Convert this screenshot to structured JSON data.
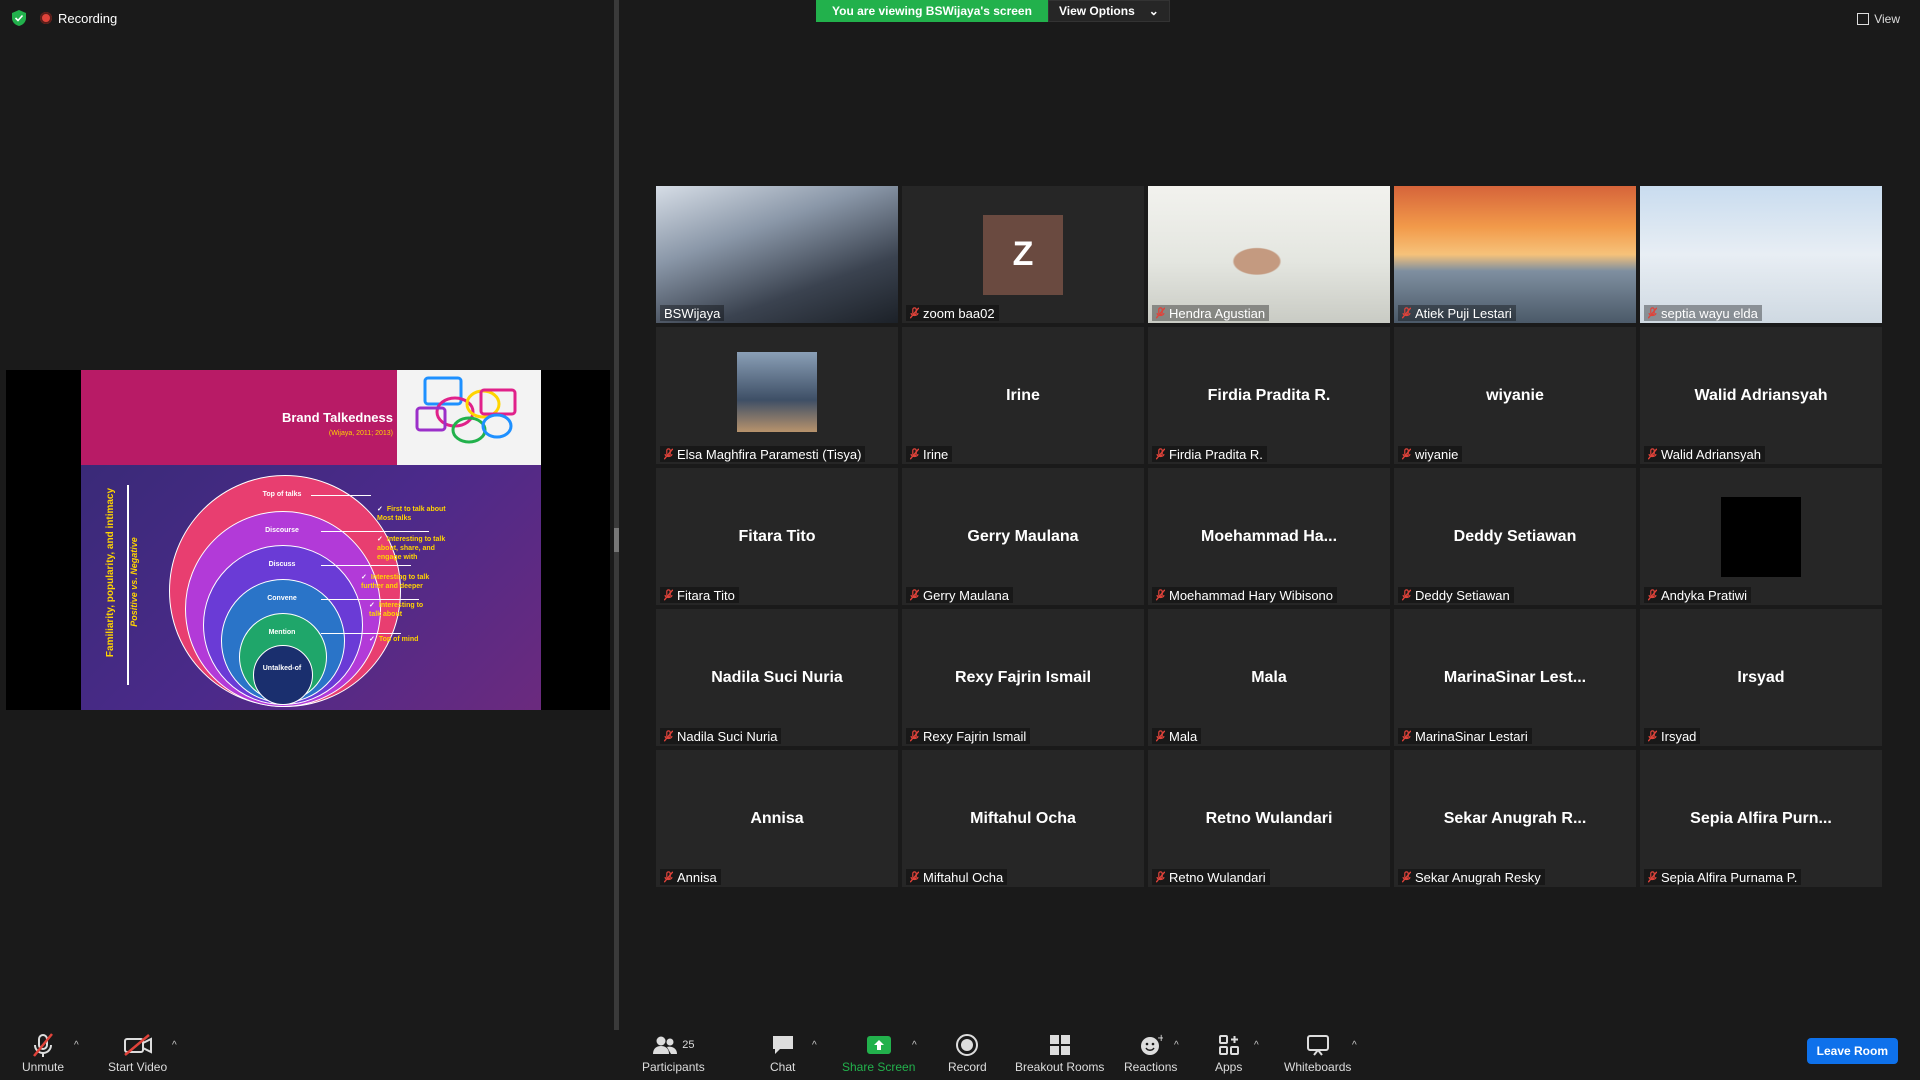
{
  "status": {
    "recording_label": "Recording"
  },
  "banner": {
    "viewing_text": "You are viewing BSWijaya's screen",
    "view_options_label": "View Options"
  },
  "view_button": {
    "label": "View"
  },
  "slide": {
    "title": "Brand Talkedness",
    "citation": "(Wijaya, 2011; 2013)",
    "vertical_axis": "Familiarity, popularity, and intimacy",
    "vertical_axis2": "Positive vs. Negative",
    "levels": [
      "Top of talks",
      "Discourse",
      "Discuss",
      "Convene",
      "Mention",
      "Untalked-of"
    ],
    "notes": [
      "First to talk about\nMost talks",
      "Interesting to talk\nabout, share, and\nengage with",
      "Interesting to talk\nfurther and deeper",
      "Interesting to\ntalk about",
      "Top of mind"
    ]
  },
  "tiles": [
    {
      "name": "BSWijaya",
      "center": "",
      "kind": "video-city",
      "active": true,
      "muted": false
    },
    {
      "name": "zoom baa02",
      "center": "",
      "kind": "avatar-z",
      "active": false,
      "muted": true
    },
    {
      "name": "Hendra Agustian",
      "center": "",
      "kind": "video-office",
      "active": false,
      "muted": true
    },
    {
      "name": "Atiek Puji Lestari",
      "center": "",
      "kind": "video-sunset",
      "active": false,
      "muted": true
    },
    {
      "name": "septia wayu elda",
      "center": "",
      "kind": "video-sky",
      "active": false,
      "muted": true
    },
    {
      "name": "Elsa Maghfira Paramesti (Tisya)",
      "center": "",
      "kind": "photo",
      "active": false,
      "muted": true
    },
    {
      "name": "Irine",
      "center": "Irine",
      "kind": "text",
      "active": false,
      "muted": true
    },
    {
      "name": "Firdia Pradita R.",
      "center": "Firdia Pradita R.",
      "kind": "text",
      "active": false,
      "muted": true
    },
    {
      "name": "wiyanie",
      "center": "wiyanie",
      "kind": "text",
      "active": false,
      "muted": true
    },
    {
      "name": "Walid Adriansyah",
      "center": "Walid Adriansyah",
      "kind": "text",
      "active": false,
      "muted": true
    },
    {
      "name": "Fitara Tito",
      "center": "Fitara Tito",
      "kind": "text",
      "active": false,
      "muted": true
    },
    {
      "name": "Gerry Maulana",
      "center": "Gerry Maulana",
      "kind": "text",
      "active": false,
      "muted": true
    },
    {
      "name": "Moehammad Hary Wibisono",
      "center": "Moehammad  Ha...",
      "kind": "text",
      "active": false,
      "muted": true
    },
    {
      "name": "Deddy Setiawan",
      "center": "Deddy Setiawan",
      "kind": "text",
      "active": false,
      "muted": true
    },
    {
      "name": "Andyka Pratiwi",
      "center": "",
      "kind": "black",
      "active": false,
      "muted": true
    },
    {
      "name": "Nadila Suci Nuria",
      "center": "Nadila Suci Nuria",
      "kind": "text",
      "active": false,
      "muted": true
    },
    {
      "name": "Rexy Fajrin Ismail",
      "center": "Rexy Fajrin Ismail",
      "kind": "text",
      "active": false,
      "muted": true
    },
    {
      "name": "Mala",
      "center": "Mala",
      "kind": "text",
      "active": false,
      "muted": true
    },
    {
      "name": "MarinaSinar Lestari",
      "center": "MarinaSinar  Lest...",
      "kind": "text",
      "active": false,
      "muted": true
    },
    {
      "name": "Irsyad",
      "center": "Irsyad",
      "kind": "text",
      "active": false,
      "muted": true
    },
    {
      "name": "Annisa",
      "center": "Annisa",
      "kind": "text",
      "active": false,
      "muted": true
    },
    {
      "name": "Miftahul Ocha",
      "center": "Miftahul Ocha",
      "kind": "text",
      "active": false,
      "muted": true
    },
    {
      "name": "Retno Wulandari",
      "center": "Retno Wulandari",
      "kind": "text",
      "active": false,
      "muted": true
    },
    {
      "name": "Sekar Anugrah Resky",
      "center": "Sekar  Anugrah  R...",
      "kind": "text",
      "active": false,
      "muted": true
    },
    {
      "name": "Sepia Alfira Purnama P.",
      "center": "Sepia  Alfira  Purn...",
      "kind": "text",
      "active": false,
      "muted": true
    }
  ],
  "toolbar": {
    "unmute": "Unmute",
    "start_video": "Start Video",
    "participants": "Participants",
    "participants_count": "25",
    "chat": "Chat",
    "share_screen": "Share Screen",
    "record": "Record",
    "breakout_rooms": "Breakout Rooms",
    "reactions": "Reactions",
    "apps": "Apps",
    "whiteboards": "Whiteboards",
    "leave": "Leave Room"
  },
  "colors": {
    "share_green": "#22b14c",
    "active_border": "#c8f03c",
    "leave_blue": "#0e71eb",
    "muted_red": "#e0433a"
  }
}
